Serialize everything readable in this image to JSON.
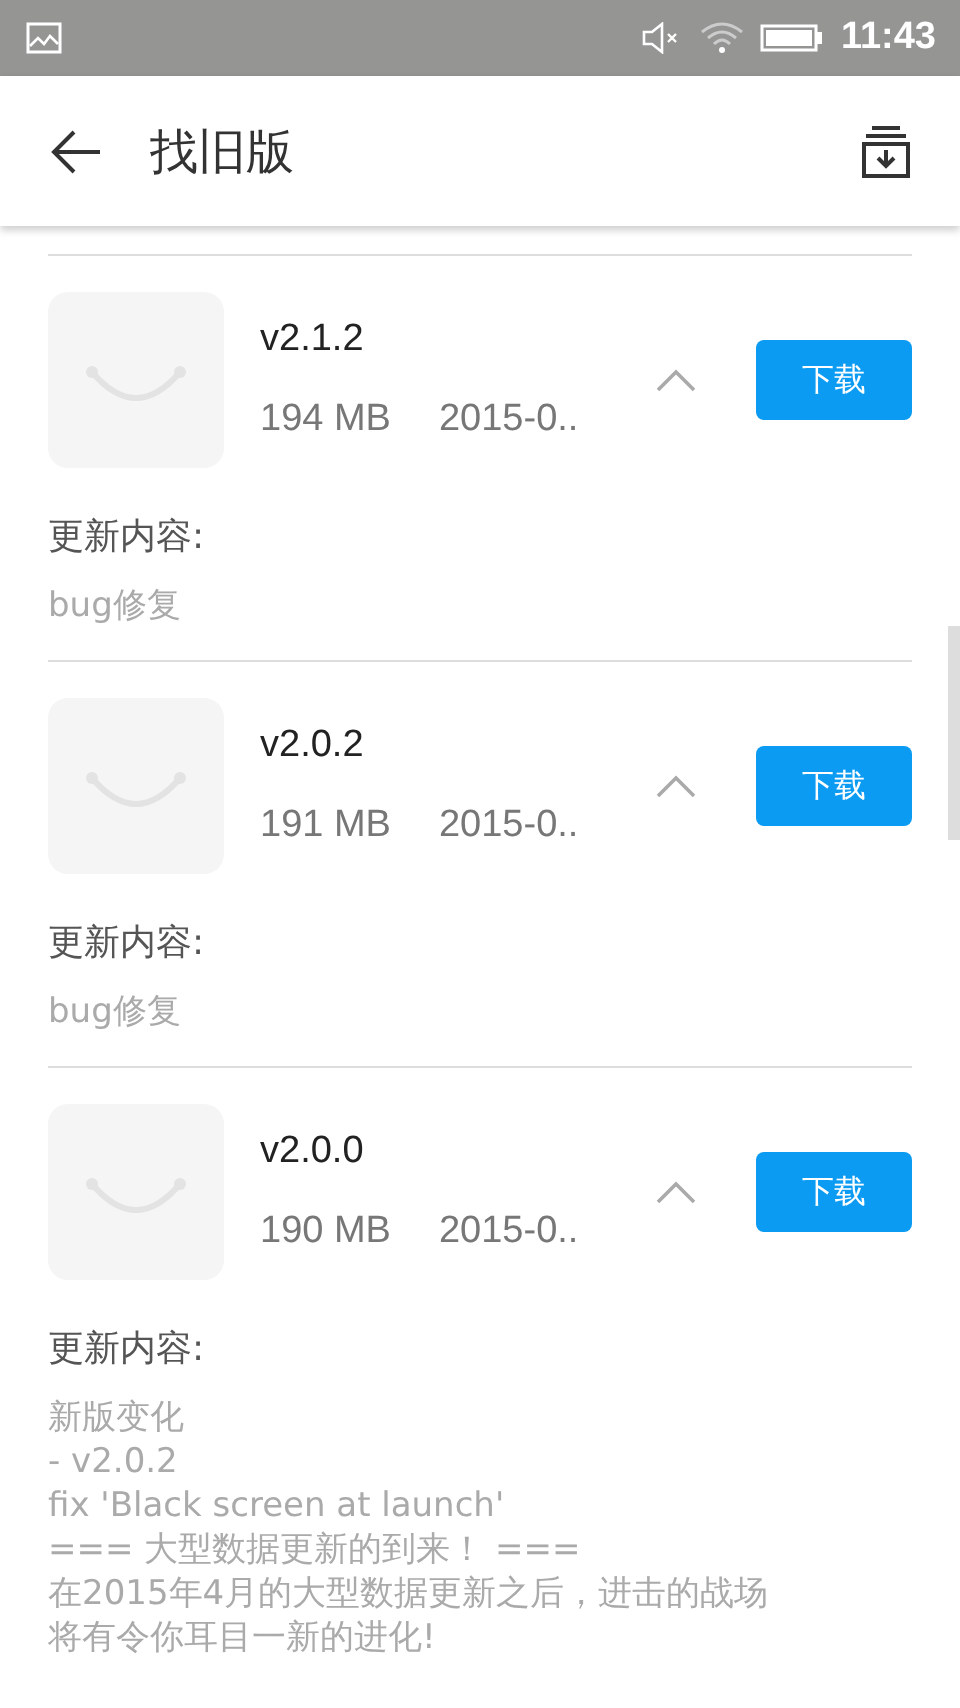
{
  "status_bar": {
    "time": "11:43"
  },
  "app_bar": {
    "title": "找旧版"
  },
  "versions": [
    {
      "version": "v2.1.2",
      "size": "194 MB",
      "date": "2015-0..",
      "button": "下载",
      "notes_label": "更新内容:",
      "notes": [
        "bug修复"
      ]
    },
    {
      "version": "v2.0.2",
      "size": "191 MB",
      "date": "2015-0..",
      "button": "下载",
      "notes_label": "更新内容:",
      "notes": [
        "bug修复"
      ]
    },
    {
      "version": "v2.0.0",
      "size": "190 MB",
      "date": "2015-0..",
      "button": "下载",
      "notes_label": "更新内容:",
      "notes": [
        "新版变化",
        "- v2.0.2",
        "fix 'Black screen at launch'",
        "=== 大型数据更新的到来！ ===",
        "在2015年4月的大型数据更新之后，进击的战场",
        "将有令你耳目一新的进化!"
      ]
    }
  ]
}
